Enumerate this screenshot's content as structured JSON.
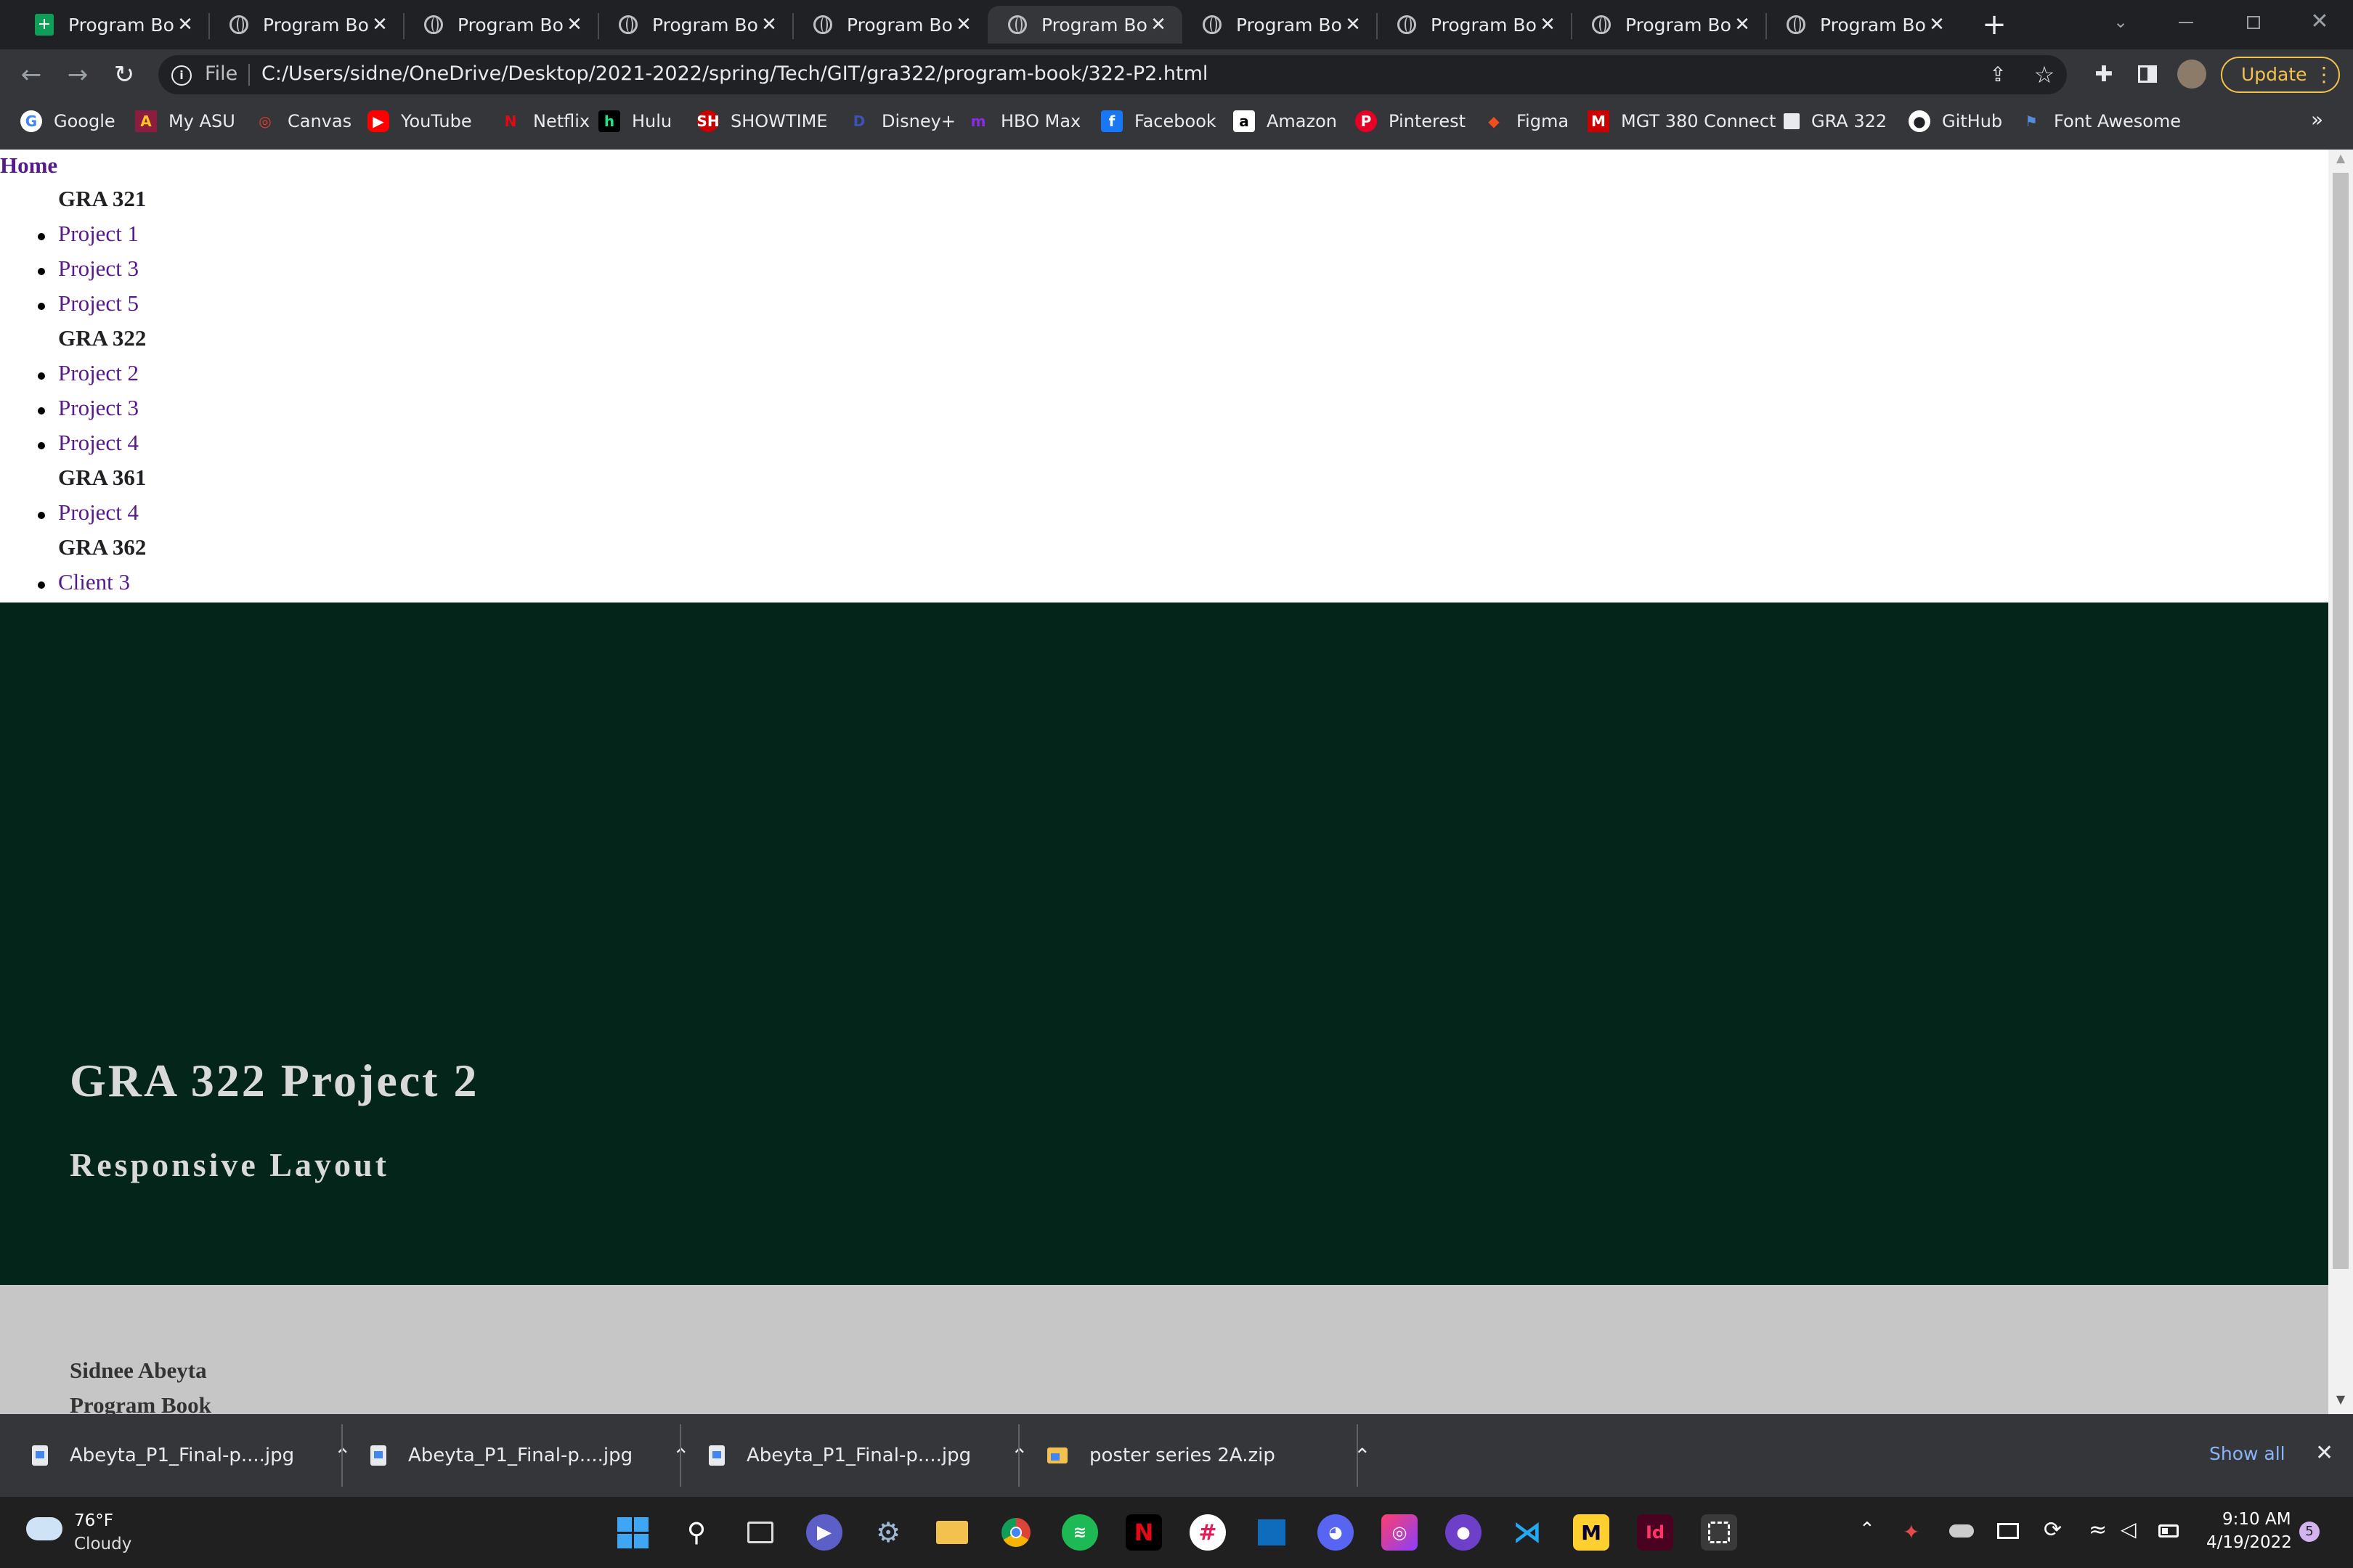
{
  "browser": {
    "tabs": [
      {
        "title": "Program Boo",
        "active": false
      },
      {
        "title": "Program Boo",
        "active": false
      },
      {
        "title": "Program Boo",
        "active": false
      },
      {
        "title": "Program Boo",
        "active": false
      },
      {
        "title": "Program Boo",
        "active": false
      },
      {
        "title": "Program Boo",
        "active": true
      },
      {
        "title": "Program Boo",
        "active": false
      },
      {
        "title": "Program Boo",
        "active": false
      },
      {
        "title": "Program Boo",
        "active": false
      },
      {
        "title": "Program Boo",
        "active": false
      }
    ],
    "new_tab_icon": "+",
    "address_prefix": "File",
    "url": "C:/Users/sidne/OneDrive/Desktop/2021-2022/spring/Tech/GIT/gra322/program-book/322-P2.html",
    "update_label": "Update",
    "bookmarks": [
      "Google",
      "My ASU",
      "Canvas",
      "YouTube",
      "Netflix",
      "Hulu",
      "SHOWTIME",
      "Disney+",
      "HBO Max",
      "Facebook",
      "Amazon",
      "Pinterest",
      "Figma",
      "MGT 380 Connect",
      "GRA 322",
      "GitHub",
      "Font Awesome"
    ],
    "bookmarks_more": "»"
  },
  "page": {
    "home_link": "Home",
    "nav_groups": [
      {
        "heading": "GRA 321",
        "items": [
          "Project 1",
          "Project 3",
          "Project 5"
        ]
      },
      {
        "heading": "GRA 322",
        "items": [
          "Project 2",
          "Project 3",
          "Project 4"
        ]
      },
      {
        "heading": "GRA 361",
        "items": [
          "Project 4"
        ]
      },
      {
        "heading": "GRA 362",
        "items": [
          "Client 3"
        ]
      }
    ],
    "hero_title": "GRA 322 Project 2",
    "hero_subtitle": "Responsive Layout",
    "footer_name": "Sidnee Abeyta",
    "footer_book": "Program Book",
    "colors": {
      "hero_bg": "#04251a",
      "footer_bg": "#c6c6c6",
      "link": "#551a8b"
    }
  },
  "downloads": {
    "items": [
      "Abeyta_P1_Final-p....jpg",
      "Abeyta_P1_Final-p....jpg",
      "Abeyta_P1_Final-p....jpg",
      "poster series 2A.zip"
    ],
    "show_all": "Show all"
  },
  "taskbar": {
    "weather_temp": "76°F",
    "weather_desc": "Cloudy",
    "time": "9:10 AM",
    "date": "4/19/2022",
    "notification_count": "5"
  }
}
